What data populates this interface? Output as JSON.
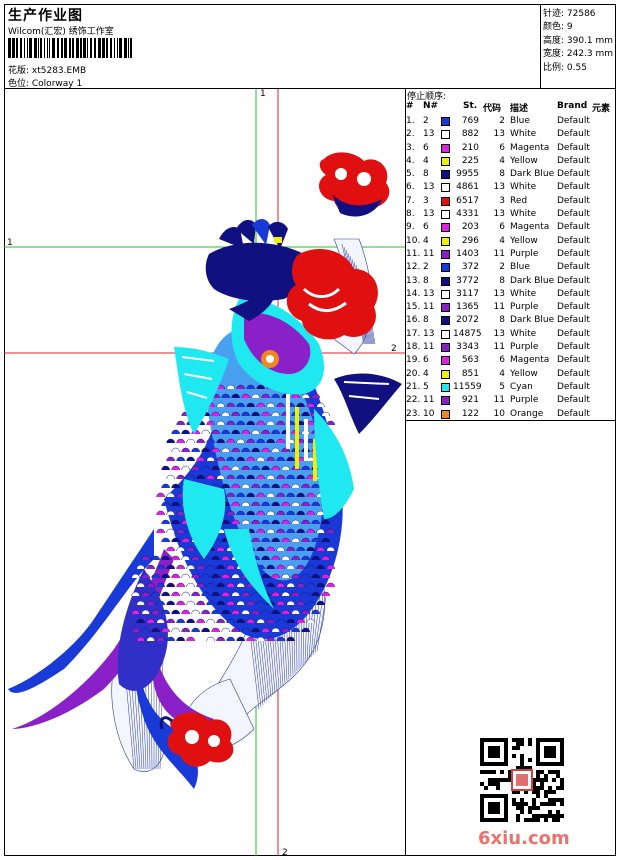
{
  "header": {
    "title": "生产作业图",
    "company": "Wilcom(汇宏) 绣饰工作室",
    "design_label": "花版: xt5283.EMB",
    "colorway_label": "色位: Colorway 1"
  },
  "stats": {
    "stitches": "针迹: 72586",
    "colors": "颜色: 9",
    "height": "高度: 390.1 mm",
    "width": "宽度: 242.3 mm",
    "scale": "比例: 0.55"
  },
  "canvas": {
    "guide_v1": "1",
    "guide_v2": "2",
    "guide_h1": "1",
    "guide_h2": "2"
  },
  "stop_sequence": {
    "caption": "停止顺序:",
    "columns": {
      "index": "#",
      "needle": "N#",
      "stitches": "St.",
      "code": "代码",
      "description": "描述",
      "brand": "Brand",
      "element": "元素"
    },
    "rows": [
      {
        "index": "1.",
        "needle": "2",
        "color": "#1a3ad8",
        "stitches": "769",
        "code": "2",
        "description": "Blue",
        "brand": "Default"
      },
      {
        "index": "2.",
        "needle": "13",
        "color": "#ffffff",
        "stitches": "882",
        "code": "13",
        "description": "White",
        "brand": "Default"
      },
      {
        "index": "3.",
        "needle": "6",
        "color": "#e020e0",
        "stitches": "210",
        "code": "6",
        "description": "Magenta",
        "brand": "Default"
      },
      {
        "index": "4.",
        "needle": "4",
        "color": "#f0f000",
        "stitches": "225",
        "code": "4",
        "description": "Yellow",
        "brand": "Default"
      },
      {
        "index": "5.",
        "needle": "8",
        "color": "#101080",
        "stitches": "9955",
        "code": "8",
        "description": "Dark Blue",
        "brand": "Default"
      },
      {
        "index": "6.",
        "needle": "13",
        "color": "#ffffff",
        "stitches": "4861",
        "code": "13",
        "description": "White",
        "brand": "Default"
      },
      {
        "index": "7.",
        "needle": "3",
        "color": "#e01010",
        "stitches": "6517",
        "code": "3",
        "description": "Red",
        "brand": "Default"
      },
      {
        "index": "8.",
        "needle": "13",
        "color": "#ffffff",
        "stitches": "4331",
        "code": "13",
        "description": "White",
        "brand": "Default"
      },
      {
        "index": "9.",
        "needle": "6",
        "color": "#e020e0",
        "stitches": "203",
        "code": "6",
        "description": "Magenta",
        "brand": "Default"
      },
      {
        "index": "10.",
        "needle": "4",
        "color": "#f0f000",
        "stitches": "296",
        "code": "4",
        "description": "Yellow",
        "brand": "Default"
      },
      {
        "index": "11.",
        "needle": "11",
        "color": "#8a20c8",
        "stitches": "1403",
        "code": "11",
        "description": "Purple",
        "brand": "Default"
      },
      {
        "index": "12.",
        "needle": "2",
        "color": "#1a3ad8",
        "stitches": "372",
        "code": "2",
        "description": "Blue",
        "brand": "Default"
      },
      {
        "index": "13.",
        "needle": "8",
        "color": "#101080",
        "stitches": "3772",
        "code": "8",
        "description": "Dark Blue",
        "brand": "Default"
      },
      {
        "index": "14.",
        "needle": "13",
        "color": "#ffffff",
        "stitches": "3117",
        "code": "13",
        "description": "White",
        "brand": "Default"
      },
      {
        "index": "15.",
        "needle": "11",
        "color": "#8a20c8",
        "stitches": "1365",
        "code": "11",
        "description": "Purple",
        "brand": "Default"
      },
      {
        "index": "16.",
        "needle": "8",
        "color": "#101080",
        "stitches": "2072",
        "code": "8",
        "description": "Dark Blue",
        "brand": "Default"
      },
      {
        "index": "17.",
        "needle": "13",
        "color": "#ffffff",
        "stitches": "14875",
        "code": "13",
        "description": "White",
        "brand": "Default"
      },
      {
        "index": "18.",
        "needle": "11",
        "color": "#8a20c8",
        "stitches": "3343",
        "code": "11",
        "description": "Purple",
        "brand": "Default"
      },
      {
        "index": "19.",
        "needle": "6",
        "color": "#e020e0",
        "stitches": "563",
        "code": "6",
        "description": "Magenta",
        "brand": "Default"
      },
      {
        "index": "20.",
        "needle": "4",
        "color": "#f0f000",
        "stitches": "851",
        "code": "4",
        "description": "Yellow",
        "brand": "Default"
      },
      {
        "index": "21.",
        "needle": "5",
        "color": "#20e8f0",
        "stitches": "11559",
        "code": "5",
        "description": "Cyan",
        "brand": "Default"
      },
      {
        "index": "22.",
        "needle": "11",
        "color": "#8a20c8",
        "stitches": "921",
        "code": "11",
        "description": "Purple",
        "brand": "Default"
      },
      {
        "index": "23.",
        "needle": "10",
        "color": "#f08820",
        "stitches": "122",
        "code": "10",
        "description": "Orange",
        "brand": "Default"
      }
    ]
  },
  "watermark": {
    "text": "6xiu.com"
  }
}
